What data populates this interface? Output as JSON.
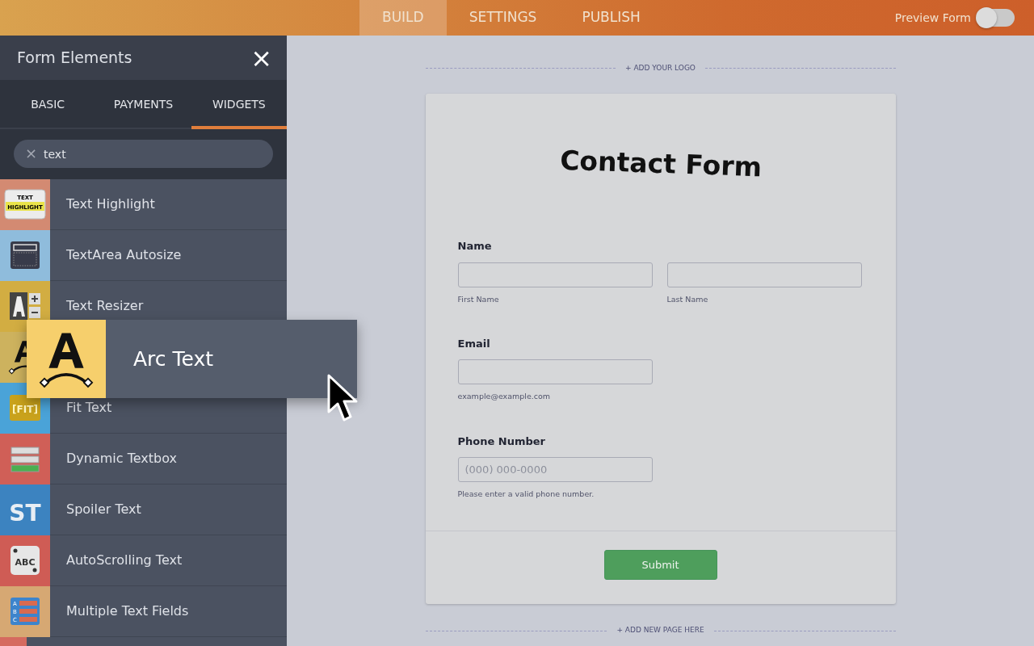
{
  "top_tabs": [
    {
      "label": "BUILD",
      "selected": true
    },
    {
      "label": "SETTINGS",
      "selected": false
    },
    {
      "label": "PUBLISH",
      "selected": false
    }
  ],
  "preview": {
    "label": "Preview Form",
    "on": false
  },
  "sidebar": {
    "title": "Form Elements",
    "close": "×",
    "tabs": [
      {
        "label": "BASIC",
        "selected": false
      },
      {
        "label": "PAYMENTS",
        "selected": false
      },
      {
        "label": "WIDGETS",
        "selected": true
      }
    ],
    "search": {
      "clear": "×",
      "value": "text"
    },
    "items": [
      {
        "kind": "row",
        "label": "Text Highlight",
        "color": "#d38a72",
        "icon_text": [
          "TEXT",
          "HIGHLIGHT"
        ]
      },
      {
        "kind": "row",
        "label": "TextArea Autosize",
        "color": "#8fbcdc"
      },
      {
        "kind": "row",
        "label": "Text Resizer",
        "color": "#d2ad42"
      },
      {
        "kind": "covered",
        "color": "#cdb25e"
      },
      {
        "kind": "row",
        "label": "Fit Text",
        "color": "#4aa3d8",
        "icon_text": [
          "[FIT]"
        ]
      },
      {
        "kind": "row",
        "label": "Dynamic Textbox",
        "color": "#d05f57"
      },
      {
        "kind": "row",
        "label": "Spoiler Text",
        "color": "#3c83c0",
        "icon_text": [
          "ST"
        ]
      },
      {
        "kind": "row",
        "label": "AutoScrolling Text",
        "color": "#cf5c55",
        "icon_text": [
          "ABC"
        ]
      },
      {
        "kind": "row",
        "label": "Multiple Text Fields",
        "color": "#d6a873",
        "icon_text": [
          "A",
          "B",
          "C"
        ]
      },
      {
        "kind": "covered",
        "color": "#d56a5f"
      }
    ]
  },
  "dragging": {
    "label": "Arc Text",
    "color": "#f6cf6c"
  },
  "canvas": {
    "add_logo": "+ ADD YOUR LOGO",
    "add_page": "+ ADD NEW PAGE HERE",
    "form": {
      "title": "Contact Form",
      "submit": "Submit",
      "fields": [
        {
          "label": "Name",
          "inputs": [
            {
              "sublabel": "First Name"
            },
            {
              "sublabel": "Last Name"
            }
          ]
        },
        {
          "label": "Email",
          "inputs": [
            {
              "sublabel": "example@example.com"
            }
          ]
        },
        {
          "label": "Phone Number",
          "inputs": [
            {
              "placeholder": "(000) 000-0000",
              "sublabel": "Please enter a valid phone number."
            }
          ]
        }
      ]
    }
  }
}
